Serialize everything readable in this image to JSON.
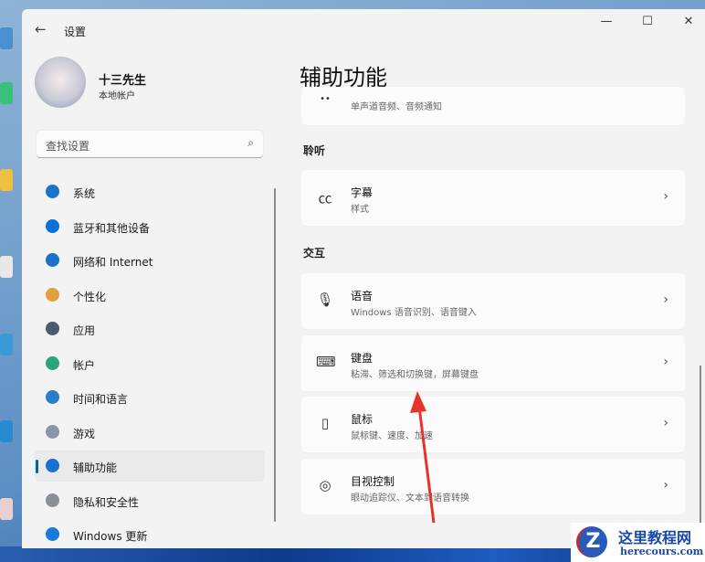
{
  "window": {
    "back_icon": "arrow-left-icon",
    "title": "设置",
    "minimize": "—",
    "maximize": "☐",
    "close": "✕"
  },
  "user": {
    "name": "十三先生",
    "type": "本地帐户"
  },
  "search": {
    "placeholder": "查找设置",
    "icon": "search-icon"
  },
  "sidebar": {
    "items": [
      {
        "label": "系统",
        "icon": "system-icon",
        "color": "#1a73c8"
      },
      {
        "label": "蓝牙和其他设备",
        "icon": "bluetooth-icon",
        "color": "#0a6fd8"
      },
      {
        "label": "网络和 Internet",
        "icon": "wifi-icon",
        "color": "#1a73c8"
      },
      {
        "label": "个性化",
        "icon": "brush-icon",
        "color": "#e0a040"
      },
      {
        "label": "应用",
        "icon": "apps-icon",
        "color": "#4a5a70"
      },
      {
        "label": "帐户",
        "icon": "account-icon",
        "color": "#2aa57a"
      },
      {
        "label": "时间和语言",
        "icon": "globe-icon",
        "color": "#2a7ec8"
      },
      {
        "label": "游戏",
        "icon": "gamepad-icon",
        "color": "#8a96a8"
      },
      {
        "label": "辅助功能",
        "icon": "accessibility-icon",
        "color": "#1a6fd0",
        "selected": true
      },
      {
        "label": "隐私和安全性",
        "icon": "shield-icon",
        "color": "#8a8f98"
      },
      {
        "label": "Windows 更新",
        "icon": "update-icon",
        "color": "#1a7ad8"
      }
    ]
  },
  "main": {
    "title": "辅助功能",
    "top_card": {
      "subtitle": "单声道音频、音频通知"
    },
    "sections": [
      {
        "header": "聆听",
        "cards": [
          {
            "title": "字幕",
            "subtitle": "样式",
            "icon": "cc-icon",
            "glyph": "㏄"
          }
        ]
      },
      {
        "header": "交互",
        "cards": [
          {
            "title": "语音",
            "subtitle": "Windows 语音识别、语音键入",
            "icon": "microphone-icon",
            "glyph": "🎙"
          },
          {
            "title": "键盘",
            "subtitle": "粘滞、筛选和切换键，屏幕键盘",
            "icon": "keyboard-icon",
            "glyph": "⌨"
          },
          {
            "title": "鼠标",
            "subtitle": "鼠标键、速度、加速",
            "icon": "mouse-icon",
            "glyph": "▯"
          },
          {
            "title": "目视控制",
            "subtitle": "眼动追踪仪、文本到语音转换",
            "icon": "eye-control-icon",
            "glyph": "◎"
          }
        ]
      }
    ]
  },
  "watermark": {
    "name": "这里教程网",
    "url": "herecours.com"
  }
}
